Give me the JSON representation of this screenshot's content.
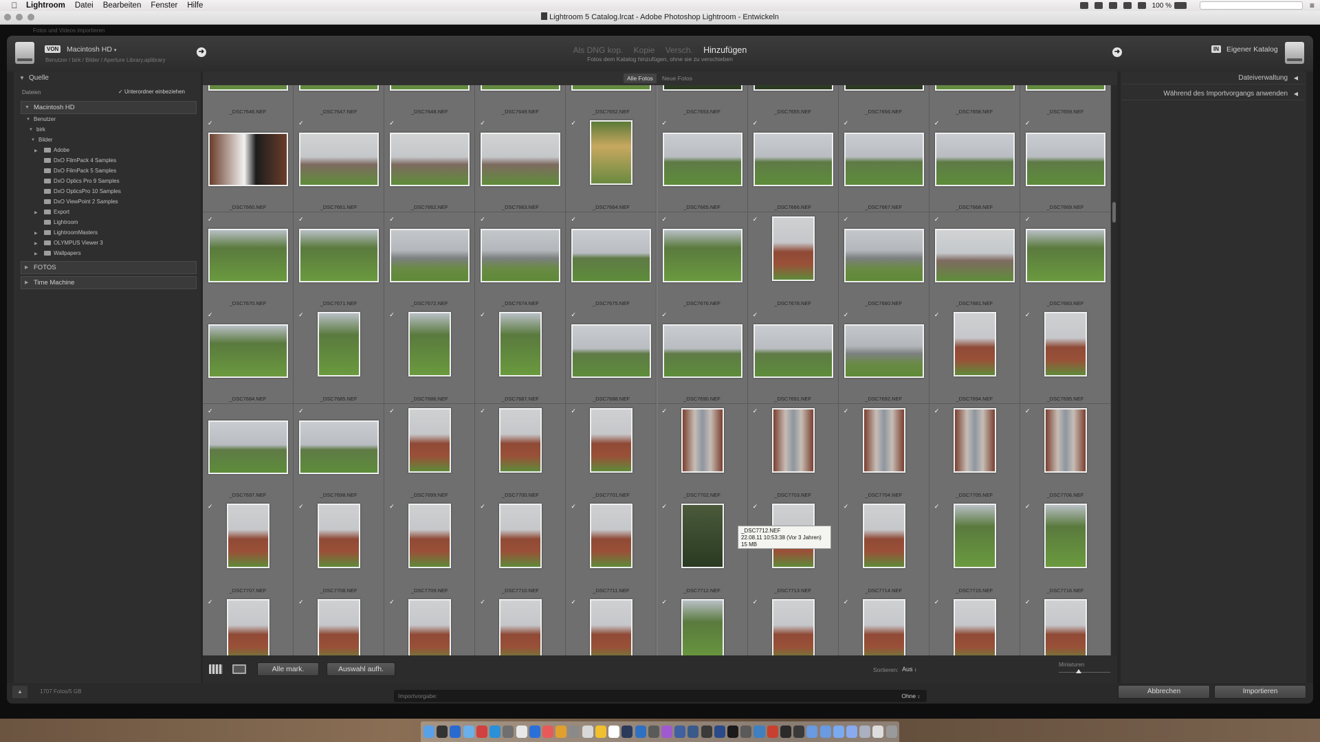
{
  "menubar": {
    "app": "Lightroom",
    "items": [
      "Datei",
      "Bearbeiten",
      "Fenster",
      "Hilfe"
    ],
    "battery": "100 %"
  },
  "window": {
    "title": "Lightroom 5 Catalog.lrcat - Adobe Photoshop Lightroom - Entwickeln",
    "hint": "Fotos und Videos importieren"
  },
  "header": {
    "from_tag": "VON",
    "from_source": "Macintosh HD",
    "from_path": "Benutzer / birk / Bilder / Aperture Library.aplibrary",
    "modes": [
      "Als DNG kop.",
      "Kopie",
      "Versch.",
      "Hinzufügen"
    ],
    "active_mode": "Hinzufügen",
    "mode_description": "Fotos dem Katalog hinzufügen, ohne sie zu verschieben",
    "to_tag": "IN",
    "to_dest": "Eigener Katalog"
  },
  "left_panel": {
    "title": "Quelle",
    "files_label": "Dateien",
    "subfolders_label": "Unterordner einbeziehen",
    "volume": "Macintosh HD",
    "tree": [
      "Benutzer",
      "birk",
      "Bilder"
    ],
    "folders": [
      "Adobe",
      "DxO FilmPack 4 Samples",
      "DxO FilmPack 5 Samples",
      "DxO Optics Pro 9 Samples",
      "DxO OpticsPro 10 Samples",
      "DxO ViewPoint 2 Samples",
      "Export",
      "Lightroom",
      "LightroomMasters",
      "OLYMPUS Viewer 3",
      "Wallpapers"
    ],
    "sections": [
      "FOTOS",
      "Time Machine"
    ]
  },
  "topbar": {
    "all": "Alle Fotos",
    "new": "Neue Fotos"
  },
  "grid": {
    "rows": [
      [
        "_DSC7646.NEF",
        "_DSC7647.NEF",
        "_DSC7648.NEF",
        "_DSC7649.NEF",
        "_DSC7652.NEF",
        "_DSC7653.NEF",
        "_DSC7655.NEF",
        "_DSC7656.NEF",
        "_DSC7658.NEF",
        "_DSC7659.NEF"
      ],
      [
        "_DSC7660.NEF",
        "_DSC7661.NEF",
        "_DSC7662.NEF",
        "_DSC7663.NEF",
        "_DSC7664.NEF",
        "_DSC7665.NEF",
        "_DSC7666.NEF",
        "_DSC7667.NEF",
        "_DSC7668.NEF",
        "_DSC7669.NEF"
      ],
      [
        "_DSC7670.NEF",
        "_DSC7671.NEF",
        "_DSC7672.NEF",
        "_DSC7674.NEF",
        "_DSC7675.NEF",
        "_DSC7676.NEF",
        "_DSC7678.NEF",
        "_DSC7680.NEF",
        "_DSC7681.NEF",
        "_DSC7683.NEF"
      ],
      [
        "_DSC7684.NEF",
        "_DSC7685.NEF",
        "_DSC7686.NEF",
        "_DSC7687.NEF",
        "_DSC7688.NEF",
        "_DSC7690.NEF",
        "_DSC7691.NEF",
        "_DSC7692.NEF",
        "_DSC7694.NEF",
        "_DSC7695.NEF"
      ],
      [
        "_DSC7697.NEF",
        "_DSC7698.NEF",
        "_DSC7699.NEF",
        "_DSC7700.NEF",
        "_DSC7701.NEF",
        "_DSC7702.NEF",
        "_DSC7703.NEF",
        "_DSC7704.NEF",
        "_DSC7705.NEF",
        "_DSC7706.NEF"
      ],
      [
        "_DSC7707.NEF",
        "_DSC7708.NEF",
        "_DSC7709.NEF",
        "_DSC7710.NEF",
        "_DSC7711.NEF",
        "_DSC7712.NEF",
        "_DSC7713.NEF",
        "_DSC7714.NEF",
        "_DSC7715.NEF",
        "_DSC7716.NEF"
      ],
      [
        "",
        "",
        "",
        "",
        "",
        "",
        "",
        "",
        "",
        ""
      ]
    ]
  },
  "tooltip": {
    "name": "_DSC7712.NEF",
    "date": "22.08.11 10:53:38 (Vor 3 Jahren)",
    "size": "15 MB"
  },
  "toolbar": {
    "check_all": "Alle mark.",
    "uncheck": "Auswahl aufh.",
    "sort_label": "Sortieren:",
    "sort_value": "Aus",
    "thumbs_label": "Miniaturen"
  },
  "right_panel": {
    "file_handling": "Dateiverwaltung",
    "apply_during": "Während des Importvorgangs anwenden"
  },
  "bottom": {
    "count": "1707 Fotos/5 GB",
    "preset_label": "Importvorgabe:",
    "preset_value": "Ohne",
    "cancel": "Abbrechen",
    "import": "Importieren"
  }
}
